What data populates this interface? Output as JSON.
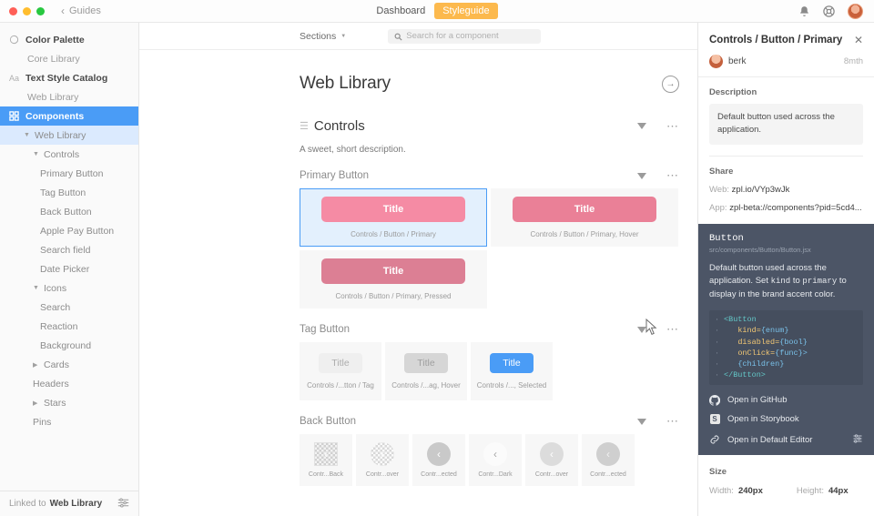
{
  "titlebar": {
    "back_label": "Guides",
    "tabs": [
      {
        "label": "Dashboard",
        "active": false
      },
      {
        "label": "Styleguide",
        "active": true
      }
    ],
    "icons": [
      "bell-icon",
      "help-icon",
      "avatar"
    ],
    "accent": "#fcb94d"
  },
  "sidebar": {
    "items": [
      {
        "label": "Color Palette",
        "type": "head",
        "icon": "palette-icon"
      },
      {
        "label": "Core Library",
        "type": "sub"
      },
      {
        "label": "Text Style Catalog",
        "type": "head",
        "icon": "Aa"
      },
      {
        "label": "Web Library",
        "type": "sub"
      },
      {
        "label": "Components",
        "type": "head",
        "icon": "grid-icon",
        "selected": true
      },
      {
        "label": "Web Library",
        "type": "lvl2",
        "expanded": true,
        "sel_light": true
      },
      {
        "label": "Controls",
        "type": "lvl3",
        "expanded": true
      },
      {
        "label": "Primary Button",
        "type": "lvl4"
      },
      {
        "label": "Tag Button",
        "type": "lvl4"
      },
      {
        "label": "Back Button",
        "type": "lvl4"
      },
      {
        "label": "Apple Pay Button",
        "type": "lvl4"
      },
      {
        "label": "Search field",
        "type": "lvl4"
      },
      {
        "label": "Date Picker",
        "type": "lvl4"
      },
      {
        "label": "Icons",
        "type": "lvl3",
        "expanded": true
      },
      {
        "label": "Search",
        "type": "lvl4"
      },
      {
        "label": "Reaction",
        "type": "lvl4"
      },
      {
        "label": "Background",
        "type": "lvl4"
      },
      {
        "label": "Cards",
        "type": "lvl3",
        "expanded": false
      },
      {
        "label": "Headers",
        "type": "lvl3-noarrow"
      },
      {
        "label": "Stars",
        "type": "lvl3",
        "expanded": false
      },
      {
        "label": "Pins",
        "type": "lvl3-noarrow"
      }
    ],
    "footer": {
      "prefix": "Linked to",
      "library": "Web Library",
      "settings_icon": "sliders-icon"
    },
    "selected_color": "#4a9cf6",
    "sel_light_color": "#dbeafe"
  },
  "main": {
    "sections_button": "Sections",
    "search": {
      "placeholder": "Search for a component",
      "icon": "search-icon"
    },
    "page_title": "Web Library",
    "go_icon": "arrow-right-circle-icon",
    "section": {
      "title": "Controls",
      "description": "A sweet, short description.",
      "drag_icon": "hamburger-icon"
    },
    "groups": [
      {
        "title": "Primary Button",
        "kind": "primary",
        "cards": [
          {
            "label": "Title",
            "caption": "Controls / Button / Primary",
            "state": "normal",
            "selected": true
          },
          {
            "label": "Title",
            "caption": "Controls / Button / Primary, Hover",
            "state": "hover",
            "selected": false
          },
          {
            "label": "Title",
            "caption": "Controls / Button / Primary, Pressed",
            "state": "pressed",
            "selected": false
          }
        ]
      },
      {
        "title": "Tag Button",
        "kind": "tag",
        "cards": [
          {
            "label": "Title",
            "caption": "Controls /...tton / Tag",
            "state": "t1"
          },
          {
            "label": "Title",
            "caption": "Controls /...ag, Hover",
            "state": "t2"
          },
          {
            "label": "Title",
            "caption": "Controls /..., Selected",
            "state": "t3"
          }
        ]
      },
      {
        "title": "Back Button",
        "kind": "back",
        "cards": [
          {
            "caption": "Contr...Back",
            "state": "b1"
          },
          {
            "caption": "Contr...over",
            "state": "b2"
          },
          {
            "caption": "Contr...ected",
            "state": "b3"
          },
          {
            "caption": "Contr...Dark",
            "state": "b4"
          },
          {
            "caption": "Contr...over",
            "state": "b5"
          },
          {
            "caption": "Contr...ected",
            "state": "b6"
          }
        ]
      }
    ],
    "colors": {
      "primary_normal": "#f58ba4",
      "primary_hover": "#ea8097",
      "primary_pressed": "#dc7f94",
      "tag_selected": "#4a9cf6"
    }
  },
  "inspector": {
    "title": "Controls / Button / Primary",
    "close_icon": "close-icon",
    "author": {
      "name": "berk",
      "time": "8mth",
      "avatar": "avatar"
    },
    "description_label": "Description",
    "description": "Default button used across the application.",
    "share_label": "Share",
    "share": [
      {
        "key": "Web:",
        "value": "zpl.io/VYp3wJk"
      },
      {
        "key": "App:",
        "value": "zpl-beta://components?pid=5cd4..."
      }
    ],
    "code": {
      "title": "Button",
      "path": "src/components/Button/Button.jsx",
      "body_line1": "Default button used across the",
      "body_line2": "application.",
      "body_line3_a": "Set ",
      "body_line3_kind": "kind",
      "body_line3_b": " to ",
      "body_line3_primary": "primary",
      "body_line3_c": " to display in the",
      "body_line4": "brand accent color.",
      "snippet": [
        {
          "tag": "<Button"
        },
        {
          "attr": "kind=",
          "val": "{enum}"
        },
        {
          "attr": "disabled=",
          "val": "{bool}"
        },
        {
          "attr": "onClick=",
          "val": "{func}>"
        },
        {
          "plain": "{children}"
        },
        {
          "tag": "</Button>"
        }
      ],
      "links": [
        {
          "label": "Open in GitHub",
          "icon": "github-icon"
        },
        {
          "label": "Open in Storybook",
          "icon": "storybook-icon"
        },
        {
          "label": "Open in Default Editor",
          "icon": "link-icon",
          "trailing_icon": "sliders-icon"
        }
      ],
      "bg": "#4c5566"
    },
    "size_label": "Size",
    "size": {
      "width_key": "Width:",
      "width_value": "240px",
      "height_key": "Height:",
      "height_value": "44px"
    }
  }
}
